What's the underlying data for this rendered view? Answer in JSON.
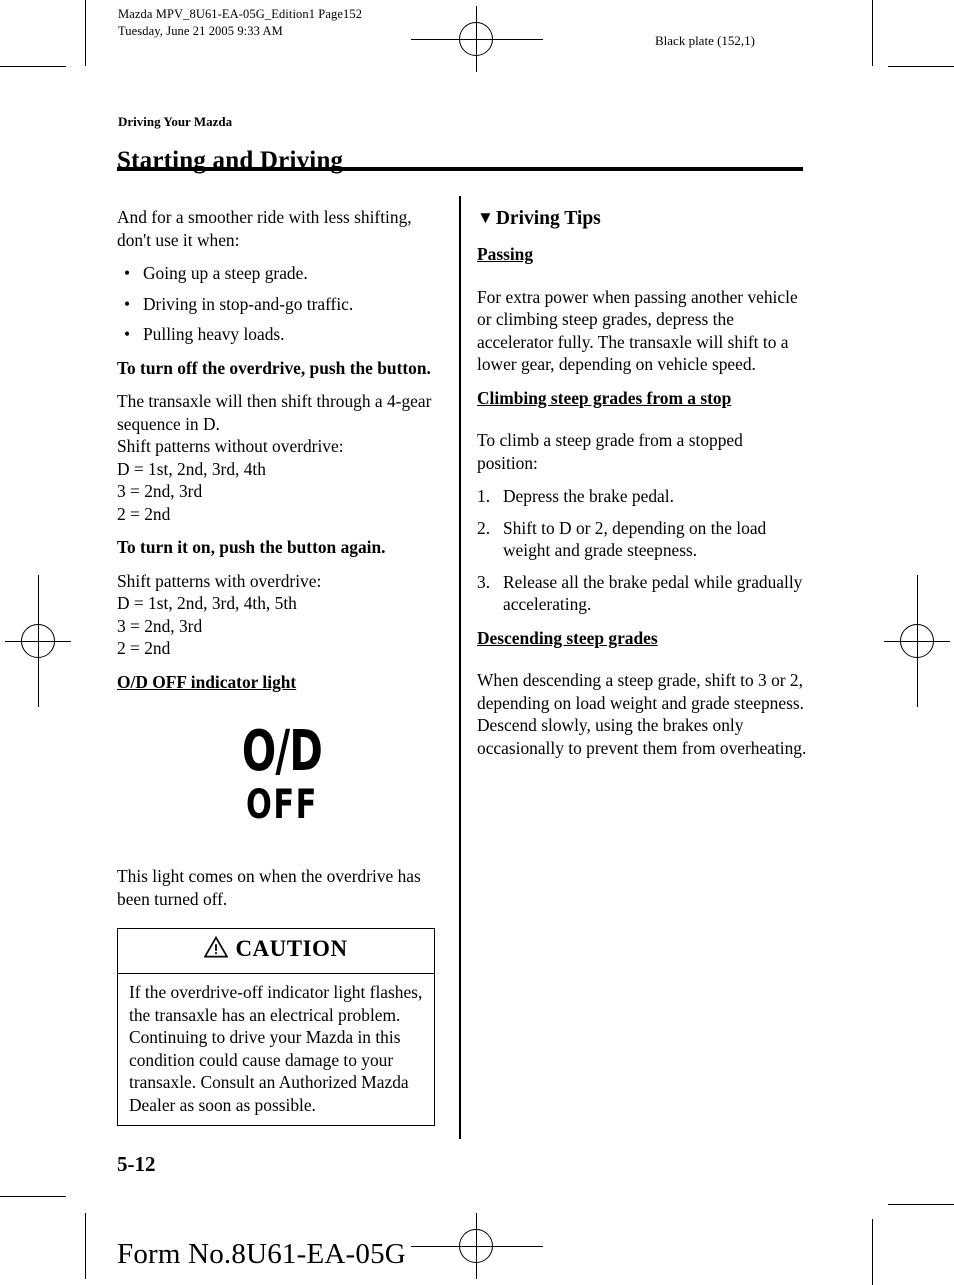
{
  "header": {
    "slug": "Mazda MPV_8U61-EA-05G_Edition1 Page152\nTuesday, June 21 2005 9:33 AM",
    "black_plate": "Black plate (152,1)"
  },
  "section": {
    "eyebrow": "Driving Your Mazda",
    "title": "Starting and Driving"
  },
  "left_column": {
    "intro": "And for a smoother ride with less shifting, don't use it when:",
    "bullets": [
      "Going up a steep grade.",
      "Driving in stop-and-go traffic.",
      "Pulling heavy loads."
    ],
    "heading_turn_off": "To turn off the overdrive, push the button.",
    "para_turn_off": "The transaxle will then shift through a 4-gear sequence in D.\nShift patterns without overdrive:\nD = 1st, 2nd, 3rd, 4th\n3 = 2nd, 3rd\n2 = 2nd",
    "heading_turn_on": "To turn it on, push the button again.",
    "para_turn_on": "Shift patterns with overdrive:\nD = 1st, 2nd, 3rd, 4th, 5th\n3 = 2nd, 3rd\n2 = 2nd",
    "heading_indicator": "O/D OFF indicator light",
    "indicator_graphic": {
      "line1": "O/D",
      "line2": "OFF"
    },
    "para_indicator": "This light comes on when the overdrive has been turned off.",
    "caution": {
      "title": "CAUTION",
      "body": "If the overdrive-off indicator light flashes, the transaxle has an electrical problem. Continuing to drive your Mazda in this condition could cause damage to your transaxle. Consult an Authorized Mazda Dealer as soon as possible."
    }
  },
  "right_column": {
    "tips_marker": "▼",
    "tips_heading": "Driving Tips",
    "passing_heading": "Passing",
    "passing_body": "For extra power when passing another vehicle or climbing steep grades, depress the accelerator fully. The transaxle will shift to a lower gear, depending on vehicle speed.",
    "climbing_heading": "Climbing steep grades from a stop",
    "climbing_intro": "To climb a steep grade from a stopped position:",
    "climbing_steps": [
      {
        "num": "1.",
        "text": "Depress the brake pedal."
      },
      {
        "num": "2.",
        "text": "Shift to D or 2, depending on the load weight and grade steepness."
      },
      {
        "num": "3.",
        "text": "Release all the brake pedal while gradually accelerating."
      }
    ],
    "descending_heading": "Descending steep grades",
    "descending_body": "When descending a steep grade, shift to 3 or 2, depending on load weight and grade steepness. Descend slowly, using the brakes only occasionally to prevent them from overheating."
  },
  "footer": {
    "page_number": "5-12",
    "form_number": "Form No.8U61-EA-05G"
  },
  "icons": {
    "bullet": "•",
    "warning_triangle": "warning-triangle-icon",
    "registration_mark": "registration-crosshair-icon"
  },
  "colors": {
    "ink": "#000000",
    "paper": "#ffffff"
  }
}
